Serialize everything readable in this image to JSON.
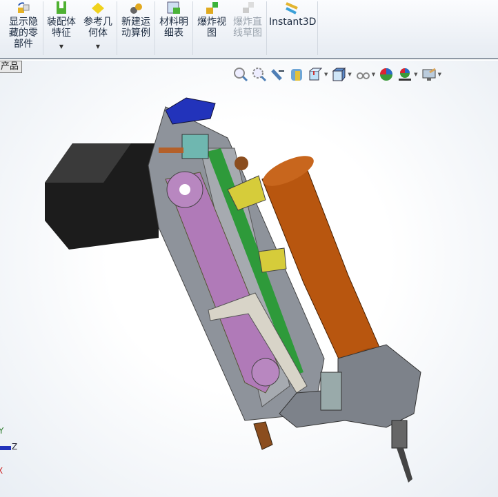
{
  "ribbon": {
    "items": [
      {
        "label": "显示隐\n藏的零\n部件",
        "icon": "show-hidden-components-icon",
        "enabled": true
      },
      {
        "label": "装配体\n特征",
        "icon": "assembly-features-icon",
        "enabled": true,
        "dropdown": true
      },
      {
        "label": "参考几\n何体",
        "icon": "reference-geometry-icon",
        "enabled": true,
        "dropdown": true
      },
      {
        "label": "新建运\n动算例",
        "icon": "new-motion-study-icon",
        "enabled": true
      },
      {
        "label": "材料明\n细表",
        "icon": "bill-of-materials-icon",
        "enabled": true
      },
      {
        "label": "爆炸视\n图",
        "icon": "exploded-view-icon",
        "enabled": true
      },
      {
        "label": "爆炸直\n线草图",
        "icon": "explode-line-sketch-icon",
        "enabled": false
      },
      {
        "label": "Instant3D",
        "icon": "instant3d-icon",
        "enabled": true
      }
    ]
  },
  "tab": {
    "label": "产品"
  },
  "heads_up_toolbar": [
    "zoom-to-fit-icon",
    "zoom-to-area-icon",
    "previous-view-icon",
    "section-view-icon",
    "view-orientation-icon",
    "display-style-icon",
    "hide-show-items-icon",
    "edit-appearance-icon",
    "apply-scene-icon",
    "view-settings-icon"
  ],
  "triad": {
    "y": "Y",
    "z": "Z",
    "x": "X"
  },
  "colors": {
    "motor": "#1c1c1c",
    "plate": "#8e939b",
    "cylinder": "#b8560f",
    "belt": "#b07ab8",
    "pcb": "#2e9a3a",
    "bracket": "#2233bb"
  }
}
